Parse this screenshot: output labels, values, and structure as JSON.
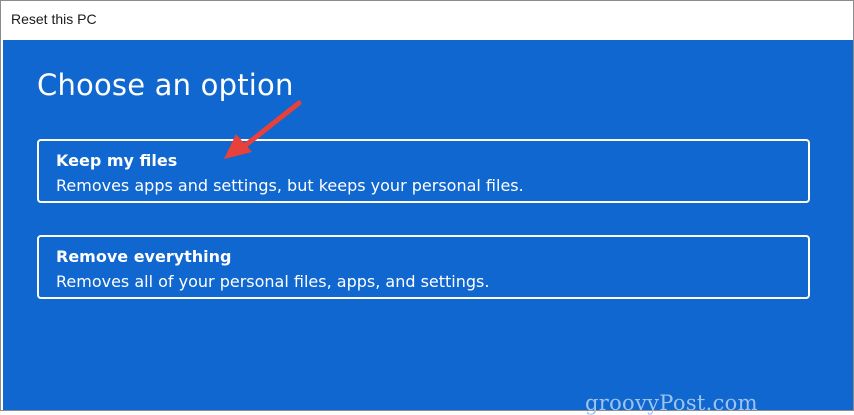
{
  "window": {
    "title": "Reset this PC"
  },
  "page": {
    "heading": "Choose an option"
  },
  "options": [
    {
      "title": "Keep my files",
      "description": "Removes apps and settings, but keeps your personal files."
    },
    {
      "title": "Remove everything",
      "description": "Removes all of your personal files, apps, and settings."
    }
  ],
  "annotation": {
    "icon": "red-arrow-icon",
    "color": "#e8403a"
  },
  "watermark": {
    "text": "groovyPost.com"
  },
  "colors": {
    "background": "#0f67cf",
    "text": "#ffffff"
  }
}
